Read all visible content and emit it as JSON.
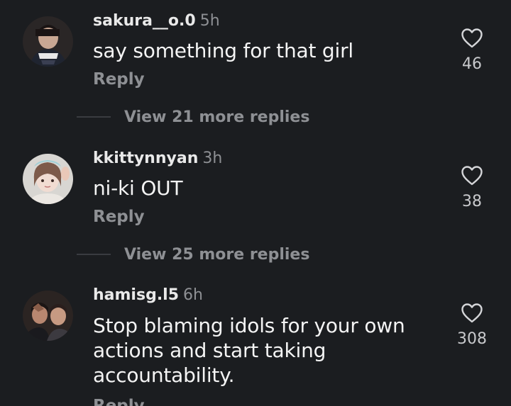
{
  "comments": [
    {
      "username": "sakura__o.0",
      "time": "5h",
      "text": "say something for that girl",
      "reply_label": "Reply",
      "likes": "46",
      "view_more": "View 21 more replies"
    },
    {
      "username": "kkittynnyan",
      "time": "3h",
      "text": "ni-ki OUT",
      "reply_label": "Reply",
      "likes": "38",
      "view_more": "View 25 more replies"
    },
    {
      "username": "hamisg.l5",
      "time": "6h",
      "text": "Stop blaming idols for your own actions and start taking accountability.",
      "reply_label": "Reply",
      "likes": "308"
    }
  ],
  "icons": {
    "like": "heart-icon"
  },
  "colors": {
    "background": "#1b1d20",
    "secondary_text": "#8e9094"
  }
}
